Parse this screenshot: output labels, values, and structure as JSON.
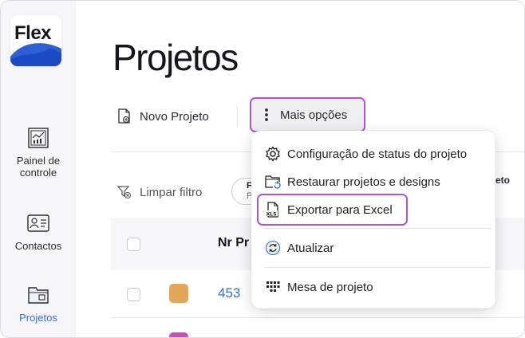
{
  "app": {
    "logo_text": "Flex"
  },
  "sidebar": {
    "items": [
      {
        "label_line1": "Painel de",
        "label_line2": "controle",
        "icon": "dashboard-chart-icon"
      },
      {
        "label": "Contactos",
        "icon": "contact-card-icon"
      },
      {
        "label": "Projetos",
        "icon": "projects-folder-icon",
        "active": true
      }
    ]
  },
  "page": {
    "title": "Projetos"
  },
  "toolbar": {
    "new_project_label": "Novo Projeto",
    "more_options_label": "Mais opções"
  },
  "filters": {
    "clear_filter_label": "Limpar filtro",
    "chip_label_partial": "F",
    "chip_value_partial": "P",
    "hidden_label_partial": "eto"
  },
  "table": {
    "header_nr": "Nr Pr",
    "rows": [
      {
        "number": "453",
        "color": "#e2a857"
      }
    ],
    "next_row_color": "#c94fb2"
  },
  "menu": {
    "items": [
      {
        "label": "Configuração de status do projeto",
        "icon": "gear-icon"
      },
      {
        "label": "Restaurar projetos e designs",
        "icon": "folder-restore-icon"
      },
      {
        "label": "Exportar para Excel",
        "icon": "xls-file-icon"
      },
      {
        "label": "Atualizar",
        "icon": "refresh-icon"
      },
      {
        "label": "Mesa de projeto",
        "icon": "grid-board-icon"
      }
    ]
  },
  "colors": {
    "accent": "#2f6fd6",
    "highlight": "#b04fe0"
  }
}
